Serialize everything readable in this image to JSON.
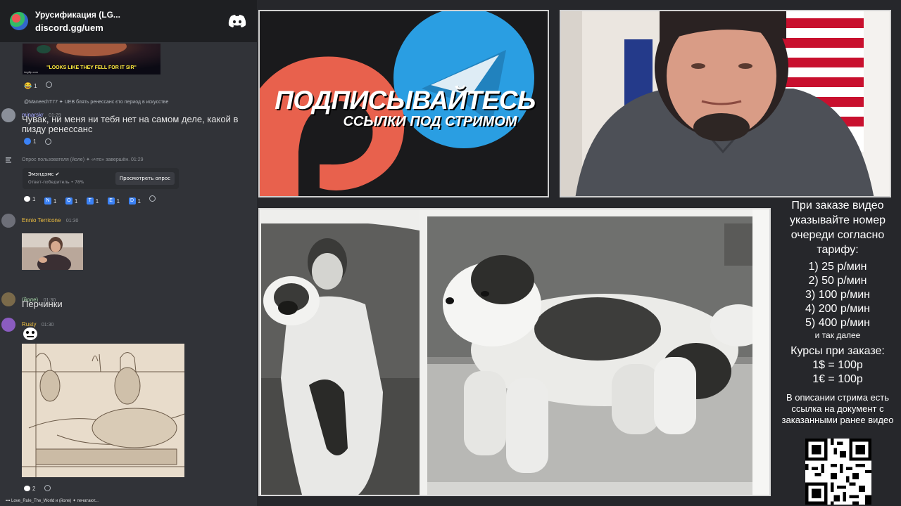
{
  "discord": {
    "server_name": "Урусификация (LG...",
    "invite": "discord.gg/uem",
    "meme_caption": "\"LOOKS LIKE THEY FELL FOR IT SIR\"",
    "meme_watermark": "imgflip.com",
    "reactions_1": [
      {
        "count": "1"
      }
    ],
    "reply_preview": "@ManeechT77 ✦ UEB блять ренессанс єто период в искусстве",
    "msg2": {
      "user": "minarskr",
      "time": "01:29",
      "text": "Чувак, ни меня ни тебя нет на самом деле, какой в пизду ренессанс",
      "reaction_count": "1"
    },
    "poll": {
      "system": "Опрос пользователя (йоле) ✦ «что» завершён. 01:29",
      "winner": "Эмэндэмс ✔",
      "winner_sub": "Ответ-победитель • 78%",
      "view_button": "Просмотреть опрос",
      "reactions": [
        {
          "label": "N",
          "count": "1",
          "color": "#3b82f6"
        },
        {
          "label": "O",
          "count": "1",
          "color": "#3b82f6"
        },
        {
          "label": "T",
          "count": "1",
          "color": "#3b82f6"
        },
        {
          "label": "E",
          "count": "1",
          "color": "#3b82f6"
        },
        {
          "label": "D",
          "count": "1",
          "color": "#3b82f6"
        }
      ],
      "first_count": "1"
    },
    "msg3": {
      "user": "Ennio Terricone",
      "time": "01:30"
    },
    "msg4": {
      "user": "(йоле)",
      "time": "01:30",
      "text": "Перчинки"
    },
    "msg5": {
      "user": "Rusty",
      "time": "01:30",
      "reaction_count": "2"
    },
    "typing": "Love_Rule_The_World и (йоле) ✦ печатают..."
  },
  "promo": {
    "title": "ПОДПИСЫВАЙТЕСЬ",
    "subtitle": "ССЫЛКИ ПОД СТРИМОМ",
    "patreon_color": "#e8614d",
    "telegram_color": "#2a9ee2"
  },
  "order_info": {
    "heading": "При заказе видео указывайте номер очереди согласно тарифу:",
    "tariffs": [
      "1) 25 р/мин",
      "2) 50 р/мин",
      "3) 100 р/мин",
      "4) 200 р/мин",
      "5) 400 р/мин"
    ],
    "etc": "и так далее",
    "rates_title": "Курсы при заказе:",
    "rate_usd": "1$ = 100р",
    "rate_eur": "1€ = 100р",
    "description": "В описании стрима есть ссылка на документ с заказанными ранее видео"
  }
}
